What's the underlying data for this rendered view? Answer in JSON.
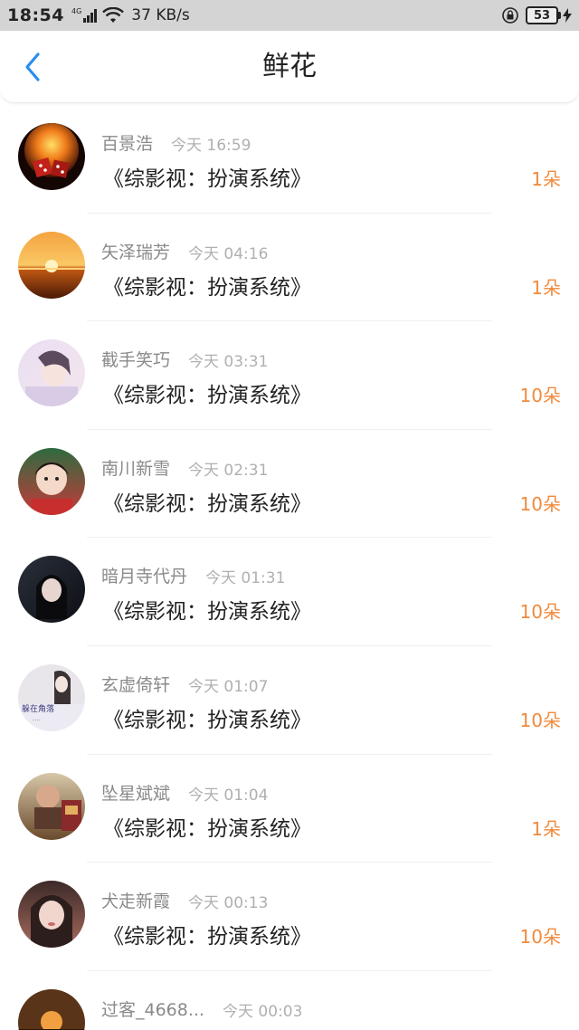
{
  "status_bar": {
    "time": "18:54",
    "network_tag": "4G",
    "speed": "37 KB/s",
    "battery": "53"
  },
  "header": {
    "title": "鲜花"
  },
  "colors": {
    "count_accent": "#f08a3c",
    "back_accent": "#2a8df0"
  },
  "rows": [
    {
      "name": "百景浩",
      "time": "今天 16:59",
      "book": "《综影视：扮演系统》",
      "count": "1朵",
      "avatar": "fire-dice"
    },
    {
      "name": "矢泽瑞芳",
      "time": "今天 04:16",
      "book": "《综影视：扮演系统》",
      "count": "1朵",
      "avatar": "sunset"
    },
    {
      "name": "截手笑巧",
      "time": "今天 03:31",
      "book": "《综影视：扮演系统》",
      "count": "10朵",
      "avatar": "pastel-portrait"
    },
    {
      "name": "南川新雪",
      "time": "今天 02:31",
      "book": "《综影视：扮演系统》",
      "count": "10朵",
      "avatar": "child-photo"
    },
    {
      "name": "暗月寺代丹",
      "time": "今天 01:31",
      "book": "《综影视：扮演系统》",
      "count": "10朵",
      "avatar": "dark-portrait"
    },
    {
      "name": "玄虚倚轩",
      "time": "今天 01:07",
      "book": "《综影视：扮演系统》",
      "count": "10朵",
      "avatar": "text-photo",
      "avatar_text": "躲在角落"
    },
    {
      "name": "坠星斌斌",
      "time": "今天 01:04",
      "book": "《综影视：扮演系统》",
      "count": "1朵",
      "avatar": "baby-photo"
    },
    {
      "name": "犬走新霞",
      "time": "今天 00:13",
      "book": "《综影视：扮演系统》",
      "count": "10朵",
      "avatar": "girl-portrait"
    },
    {
      "name": "过客_4668...",
      "time": "今天 00:03",
      "book": "",
      "count": "",
      "avatar": "sunset-dark"
    }
  ]
}
